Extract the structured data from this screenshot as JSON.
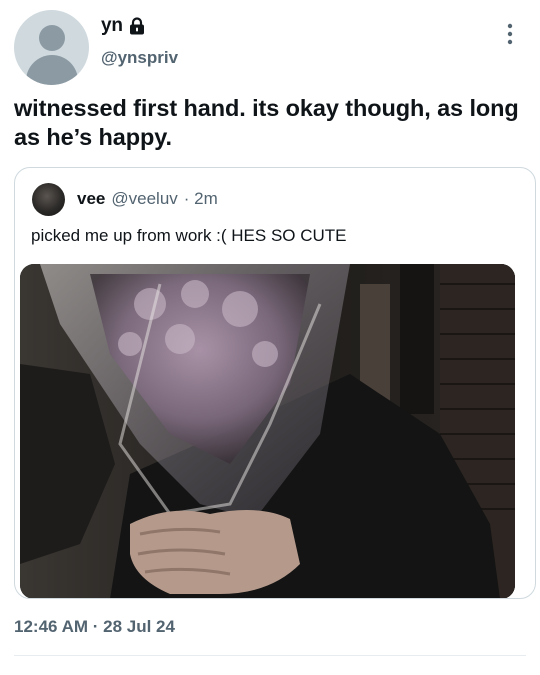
{
  "author": {
    "display_name": "yn",
    "handle": "@ynspriv",
    "protected_icon": "lock-icon"
  },
  "tweet": {
    "text": "witnessed first hand. its okay though, as long as he’s happy.",
    "timestamp": "12:46 AM · 28 Jul 24"
  },
  "quoted_tweet": {
    "display_name": "vee",
    "handle": "@veeluv",
    "time": "· 2m",
    "text": "picked me up from work :( HES SO CUTE"
  },
  "icons": {
    "more": "more-options-icon",
    "avatar": "default-avatar-icon"
  },
  "colors": {
    "text": "#0f1419",
    "secondary": "#536471",
    "border": "#cfd9de"
  }
}
